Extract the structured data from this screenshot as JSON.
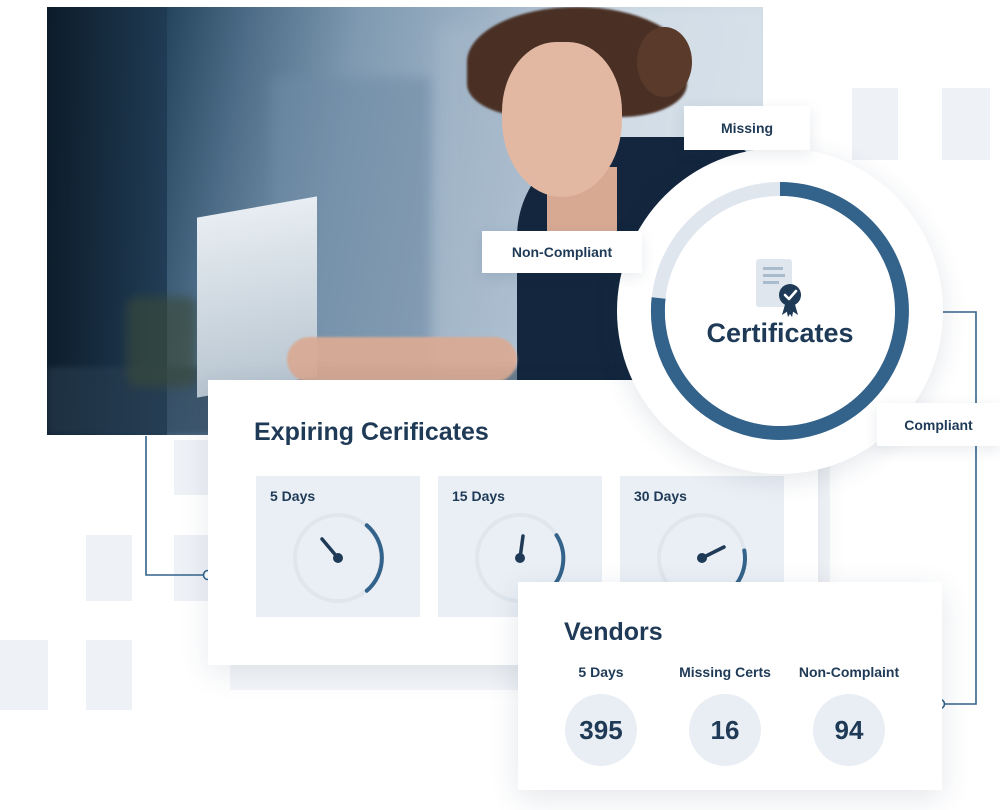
{
  "photo": {
    "subject": "woman-working-on-laptop-photo"
  },
  "certificates": {
    "title": "Certificates",
    "callouts": {
      "missing": "Missing",
      "non_compliant": "Non-Compliant",
      "compliant": "Compliant"
    }
  },
  "expiring": {
    "title": "Expiring Cerificates",
    "gauges": [
      {
        "label": "5 Days"
      },
      {
        "label": "15 Days"
      },
      {
        "label": "30 Days"
      }
    ]
  },
  "vendors": {
    "title": "Vendors",
    "stats": [
      {
        "label": "5 Days",
        "value": "395"
      },
      {
        "label": "Missing Certs",
        "value": "16"
      },
      {
        "label": "Non-Complaint",
        "value": "94"
      }
    ]
  },
  "colors": {
    "navy": "#1f3a56",
    "accent": "#33628a",
    "light": "#dfe6ee",
    "panel": "#eaeff5"
  }
}
